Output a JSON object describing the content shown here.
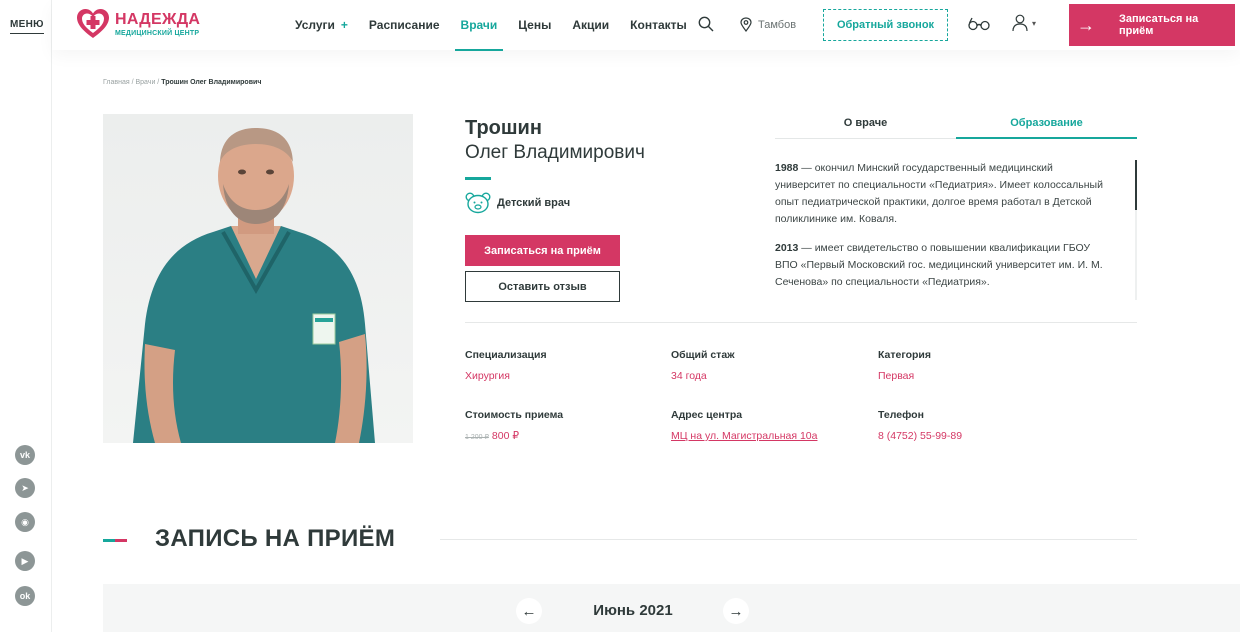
{
  "rail": {
    "menu_label": "МЕНЮ",
    "socials": [
      {
        "icon": "vk-icon",
        "glyph": "vk"
      },
      {
        "icon": "telegram-icon",
        "glyph": "➤"
      },
      {
        "icon": "whatsapp-icon",
        "glyph": "◉"
      },
      {
        "icon": "youtube-icon",
        "glyph": "▶"
      },
      {
        "icon": "odnoklassniki-icon",
        "glyph": "ok"
      }
    ]
  },
  "header": {
    "logo_name": "НАДЕЖДА",
    "logo_sub": "МЕДИЦИНСКИЙ ЦЕНТР",
    "nav": [
      {
        "label": "Услуги",
        "plus": "+"
      },
      {
        "label": "Расписание"
      },
      {
        "label": "Врачи",
        "active": true
      },
      {
        "label": "Цены"
      },
      {
        "label": "Акции"
      },
      {
        "label": "Контакты"
      }
    ],
    "city": "Тамбов",
    "callback_label": "Обратный звонок",
    "book_label": "Записаться на приём",
    "book_arrow": "→",
    "user_chevron": "▾"
  },
  "breadcrumbs": {
    "items": [
      "Главная",
      "Врачи"
    ],
    "separator": " / ",
    "current": "Трошин Олег Владимирович"
  },
  "doctor": {
    "surname": "Трошин",
    "given": "Олег Владимирович",
    "role": "Детский врач",
    "book_label": "Записаться на приём",
    "review_label": "Оставить отзыв"
  },
  "tabs": {
    "items": [
      "О враче",
      "Образование"
    ],
    "active_index": 1,
    "education": [
      {
        "year": "1988",
        "text": " — окончил Минский государственный медицинский университет по специальности «Педиатрия». Имеет колоссальный опыт педиатрической практики, долгое время работал в Детской поликлинике им. Коваля."
      },
      {
        "year": "2013",
        "text": " — имеет свидетельство о повышении квалификации ГБОУ ВПО «Первый Московский гос. медицинский университет им. И. М. Сеченова» по специальности «Педиатрия»."
      }
    ]
  },
  "facts": {
    "specialization": {
      "label": "Специализация",
      "value": "Хирургия"
    },
    "experience": {
      "label": "Общий стаж",
      "value": "34 года"
    },
    "category": {
      "label": "Категория",
      "value": "Первая"
    },
    "price": {
      "label": "Стоимость приема",
      "old": "1 200 ₽",
      "value": "800 ₽"
    },
    "address": {
      "label": "Адрес центра",
      "value": "МЦ на ул. Магистральная 10а"
    },
    "phone": {
      "label": "Телефон",
      "value": "8 (4752) 55-99-89"
    }
  },
  "booking": {
    "title": "ЗАПИСЬ НА ПРИЁМ",
    "month": "Июнь 2021",
    "prev": "←",
    "next": "→"
  },
  "colors": {
    "brand_pink": "#d43764",
    "brand_teal": "#16a79c",
    "text_dark": "#2f3a3a"
  }
}
